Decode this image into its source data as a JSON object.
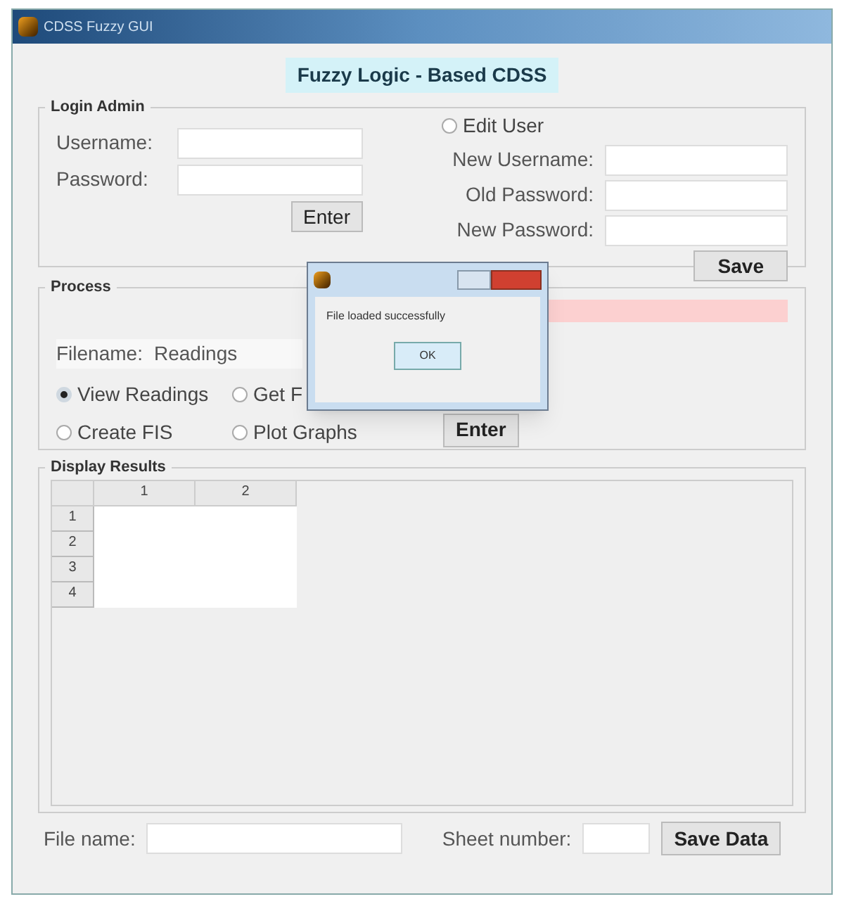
{
  "window": {
    "title": "CDSS Fuzzy GUI"
  },
  "header": "Fuzzy Logic - Based CDSS",
  "login": {
    "title": "Login Admin",
    "fields": [
      {
        "label": "Username:"
      },
      {
        "label": "Password:"
      }
    ],
    "enter": "Enter",
    "edit": {
      "label": "Edit User",
      "selected": false
    },
    "edit_fields": [
      {
        "label": "New Username:"
      },
      {
        "label": "Old Password:"
      },
      {
        "label": "New Password:"
      }
    ],
    "save": "Save"
  },
  "process": {
    "title": "Process",
    "filename_label": "Filename:",
    "filename": "Readings",
    "options": [
      {
        "label": "View Readings",
        "selected": true
      },
      {
        "label": "Get F",
        "selected": false
      },
      {
        "label": "Create FIS",
        "selected": false
      },
      {
        "label": "Plot Graphs",
        "selected": false
      }
    ],
    "enter": "Enter"
  },
  "results": {
    "title": "Display Results",
    "columns": [
      "1",
      "2"
    ],
    "rows": [
      "1",
      "2",
      "3",
      "4"
    ]
  },
  "footer": {
    "file_label": "File name:",
    "sheet_label": "Sheet number:",
    "save": "Save Data"
  },
  "dialog": {
    "message": "File loaded successfully",
    "ok": "OK"
  }
}
